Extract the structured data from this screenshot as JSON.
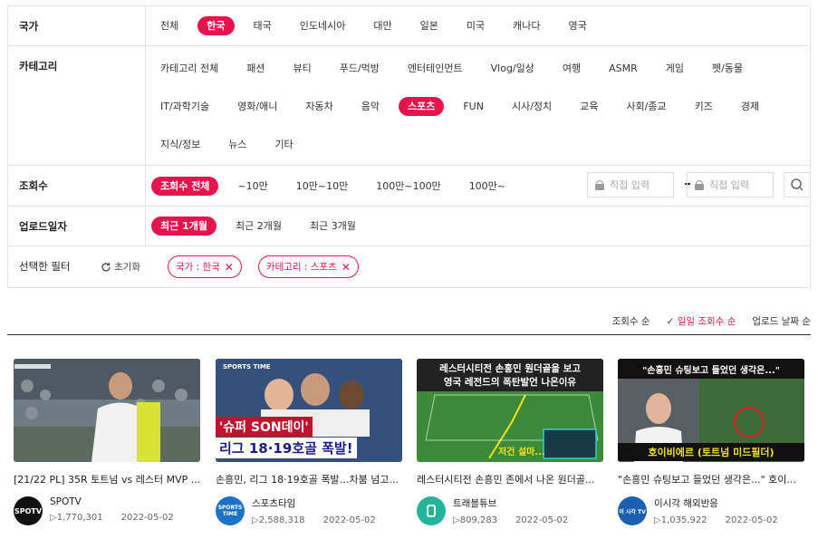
{
  "filters": {
    "country": {
      "label": "국가",
      "items": [
        "전체",
        "한국",
        "태국",
        "인도네시아",
        "대만",
        "일본",
        "미국",
        "캐나다",
        "영국"
      ],
      "active": "한국"
    },
    "category": {
      "label": "카테고리",
      "items": [
        "카테고리 전체",
        "패션",
        "뷰티",
        "푸드/먹방",
        "엔터테인먼트",
        "Vlog/일상",
        "여행",
        "ASMR",
        "게임",
        "펫/동물",
        "IT/과학기술",
        "영화/애니",
        "자동차",
        "음악",
        "스포츠",
        "FUN",
        "시사/정치",
        "교육",
        "사회/종교",
        "키즈",
        "경제",
        "지식/정보",
        "뉴스",
        "기타"
      ],
      "active": "스포츠"
    },
    "views": {
      "label": "조회수",
      "items": [
        "조회수 전체",
        "~10만",
        "10만~10만",
        "100만~100만",
        "100만~"
      ],
      "active": "조회수 전체",
      "min_placeholder": "직접 입력",
      "max_placeholder": "직접 입력"
    },
    "upload": {
      "label": "업로드일자",
      "items": [
        "최근 1개월",
        "최근 2개월",
        "최근 3개월"
      ],
      "active": "최근 1개월"
    },
    "selected": {
      "label": "선택한 필터",
      "reset": "초기화",
      "tags": [
        "국가 : 한국",
        "카테고리 : 스포츠"
      ]
    }
  },
  "sort": {
    "options": [
      "조회수 순",
      "일일 조회수 순",
      "업로드 날짜 순"
    ],
    "active": "일일 조회수 순"
  },
  "videos": [
    {
      "title": "[21/22 PL] 35R 토트넘 vs 레스터 MVP ...",
      "channel": "SPOTV",
      "views": "1,770,301",
      "date": "2022-05-02",
      "avatar_text": "SPOTV",
      "avatar_color": "#111111"
    },
    {
      "title": "손흥민, 리그 18·19호골 폭발…차붐 넘고...",
      "channel": "스포츠타임",
      "views": "2,588,318",
      "date": "2022-05-02",
      "avatar_text": "SPORTS TIME",
      "avatar_color": "#1a73c8",
      "thumb_tag": "SPORTS TIME",
      "thumb_line1": "'슈퍼 SON데이'",
      "thumb_line2": "리그 18·19호골 폭발!"
    },
    {
      "title": "레스터시티전 손흥민 존에서 나온 원더골...",
      "channel": "트래블튜브",
      "views": "809,283",
      "date": "2022-05-02",
      "avatar_text": "",
      "avatar_color": "#22b59a",
      "thumb_line1": "레스터시티전 손흥민 원더골을 보고",
      "thumb_line2": "영국 레전드의 폭탄발언 나온이유",
      "thumb_line3": "저건 설마..."
    },
    {
      "title": "\"손흥민 슈팅보고 들었던 생각은...\" 호이...",
      "channel": "이시각 해외반응",
      "views": "1,035,922",
      "date": "2022-05-02",
      "avatar_text": "이 시각 TV",
      "avatar_color": "#1b5fb3",
      "thumb_line1": "\"손흥민 슈팅보고 들었던 생각은...\"",
      "thumb_line2": "호이비에르 (토트넘 미드필더)"
    }
  ]
}
